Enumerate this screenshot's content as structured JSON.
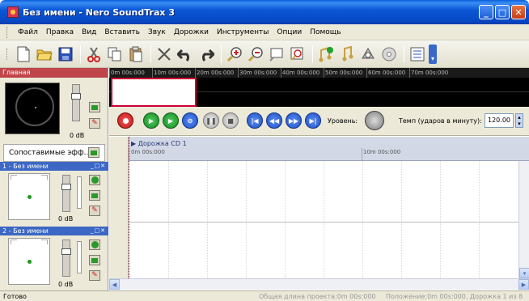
{
  "window": {
    "title": "Без имени - Nero SoundTrax 3",
    "minimize": "_",
    "maximize": "□",
    "close": "✕"
  },
  "menu": {
    "items": [
      "Файл",
      "Правка",
      "Вид",
      "Вставить",
      "Звук",
      "Дорожки",
      "Инструменты",
      "Опции",
      "Помощь"
    ]
  },
  "toolbar": {
    "icons": [
      "new-file-icon",
      "open-folder-icon",
      "save-icon",
      "cut-icon",
      "copy-icon",
      "paste-icon",
      "delete-icon",
      "undo-icon",
      "redo-icon",
      "zoom-in-icon",
      "zoom-out-icon",
      "zoom-selection-icon",
      "zoom-fit-icon",
      "add-track-icon",
      "add-audio-icon",
      "effects-icon",
      "cd-icon",
      "mixer-icon"
    ]
  },
  "master": {
    "label": "Главная",
    "db": "0 dB"
  },
  "effects": {
    "label": "Сопоставимые эфф..."
  },
  "tracks": [
    {
      "label": "1 - Без имени",
      "db": "0 dB",
      "controls": "_□✕"
    },
    {
      "label": "2 - Без имени",
      "db": "0 dB",
      "controls": "_□✕"
    }
  ],
  "timeline": {
    "ticks": [
      "0m 00s:000",
      "10m 00s:000",
      "20m 00s:000",
      "30m 00s:000",
      "40m 00s:000",
      "50m 00s:000",
      "60m 00s:000",
      "70m 00s:000"
    ]
  },
  "transport": {
    "level_label": "Уровень:",
    "tempo_label": "Темп (ударов в минуту):",
    "tempo_value": "120.00"
  },
  "track_ruler": {
    "title": "Дорожка CD 1",
    "t_start": "0m 00s:000",
    "t_mid": "10m 00s:000"
  },
  "status": {
    "ready": "Готово",
    "length": "Общая длина проекта:0m 00s:000",
    "position": "Положение:0m 00s:000, Дорожка 1 из 8"
  },
  "colors": {
    "titlebar": "#0b58d6",
    "track_header": "#3c67c4",
    "master_header": "#c0454a",
    "record": "#d22222",
    "play": "#1f9a2f",
    "nav": "#2b5fd0"
  }
}
